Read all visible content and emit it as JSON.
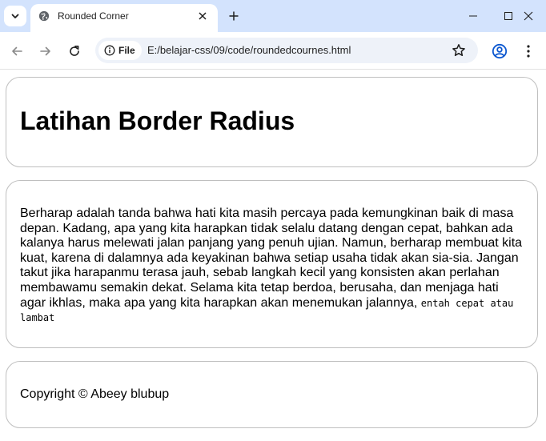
{
  "browser": {
    "tab_title": "Rounded Corner",
    "site_chip_label": "File",
    "url": "E:/belajar-css/09/code/roundedcournes.html",
    "colors": {
      "tabbar": "#d3e3fd",
      "omnibox": "#eef2f9"
    }
  },
  "page": {
    "heading": "Latihan Border Radius",
    "article": {
      "text": "Berharap adalah tanda bahwa hati kita masih percaya pada kemungkinan baik di masa depan. Kadang, apa yang kita harapkan tidak selalu datang dengan cepat, bahkan ada kalanya harus melewati jalan panjang yang penuh ujian. Namun, berharap membuat kita kuat, karena di dalamnya ada keyakinan bahwa setiap usaha tidak akan sia-sia. Jangan takut jika harapanmu terasa jauh, sebab langkah kecil yang konsisten akan perlahan membawamu semakin dekat. Selama kita tetap berdoa, berusaha, dan menjaga hati agar ikhlas, maka apa yang kita harapkan akan menemukan jalannya,",
      "mono_text": "entah cepat atau lambat"
    },
    "footer": "Copyright © Abeey blubup"
  }
}
